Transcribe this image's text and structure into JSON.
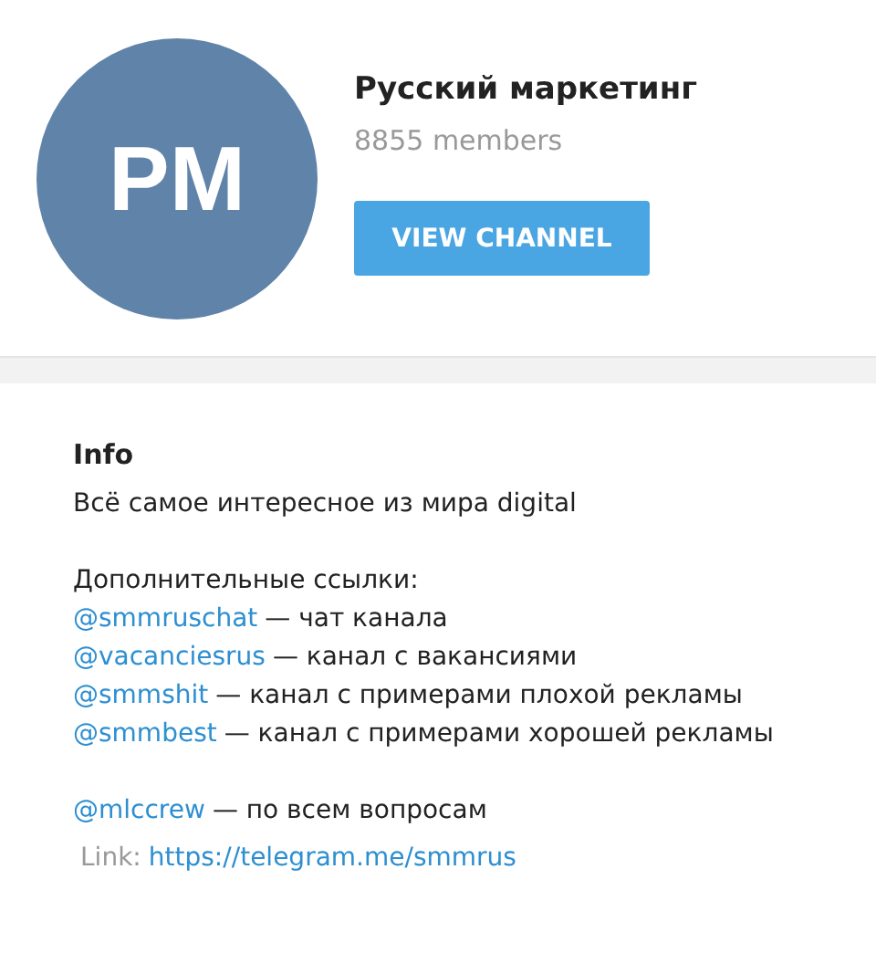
{
  "channel": {
    "avatar_text": "PM",
    "title": "Русский маркетинг",
    "members": "8855 members",
    "button": "VIEW CHANNEL"
  },
  "info": {
    "heading": "Info",
    "description": "Всё самое интересное из мира digital",
    "links_heading": "Дополнительные ссылки:",
    "links": [
      {
        "handle": "@smmruschat",
        "text": "— чат канала"
      },
      {
        "handle": "@vacanciesrus",
        "text": "— канал с вакансиями"
      },
      {
        "handle": "@smmshit",
        "text": "— канал с примерами плохой рекламы"
      },
      {
        "handle": "@smmbest",
        "text": "— канал с примерами хорошей рекламы"
      }
    ],
    "contact": {
      "handle": "@mlccrew",
      "text": "— по всем вопросам"
    },
    "link": {
      "label": "Link:",
      "url": "https://telegram.me/smmrus"
    }
  }
}
